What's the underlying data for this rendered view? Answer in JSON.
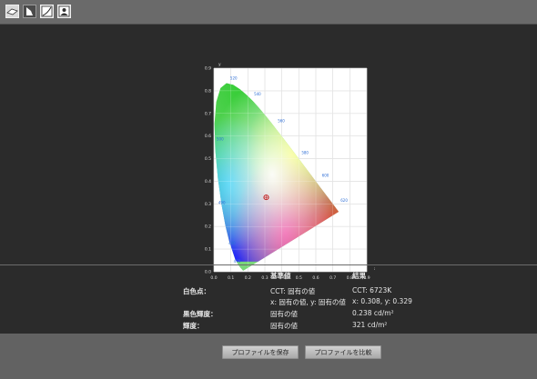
{
  "toolbar": {
    "tools": [
      {
        "name": "calibrate-tool",
        "icon": "sensor-icon"
      },
      {
        "name": "profile-tool",
        "icon": "document-icon"
      },
      {
        "name": "curve-tool",
        "icon": "curve-icon"
      },
      {
        "name": "picture-tool",
        "icon": "picture-icon"
      }
    ]
  },
  "chart_data": {
    "type": "scatter",
    "title": "",
    "xlabel": "x",
    "ylabel": "y",
    "xlim": [
      0.0,
      0.9
    ],
    "ylim": [
      0.0,
      0.9
    ],
    "x_ticks": [
      "0.0",
      "0.1",
      "0.2",
      "0.3",
      "0.4",
      "0.5",
      "0.6",
      "0.7",
      "0.8",
      "0.9"
    ],
    "y_ticks": [
      "0.0",
      "0.1",
      "0.2",
      "0.3",
      "0.4",
      "0.5",
      "0.6",
      "0.7",
      "0.8",
      "0.9"
    ],
    "grid": true,
    "locus_wavelengths": [
      "520",
      "540",
      "560",
      "580",
      "600",
      "620",
      "500",
      "490",
      "480",
      "470"
    ],
    "series": [
      {
        "points": [
          {
            "x": 0.308,
            "y": 0.329
          }
        ]
      }
    ]
  },
  "results": {
    "col_reference": "基準値",
    "col_result": "結果",
    "rows": [
      {
        "label": "白色点：",
        "reference": "CCT: 固有の値",
        "result": "CCT: 6723K"
      },
      {
        "label": "",
        "reference": "x: 固有の値, y: 固有の値",
        "result": "x: 0.308, y: 0.329"
      },
      {
        "label": "黒色輝度：",
        "reference": "固有の値",
        "result": "0.238 cd/m²"
      },
      {
        "label": "輝度：",
        "reference": "固有の値",
        "result": "321 cd/m²"
      }
    ]
  },
  "footer": {
    "save_label": "プロファイルを保存",
    "compare_label": "プロファイルを比較"
  }
}
